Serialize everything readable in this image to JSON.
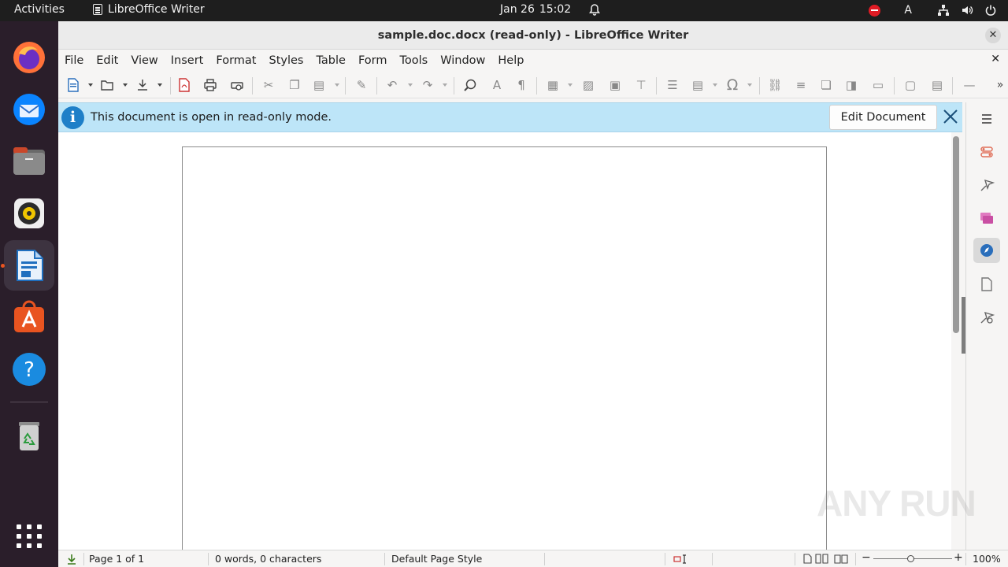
{
  "topbar": {
    "activities": "Activities",
    "app_name": "LibreOffice Writer",
    "date": "Jan 26",
    "time": "15:02",
    "input_indicator": "A"
  },
  "dock": {
    "items": [
      {
        "name": "firefox-icon"
      },
      {
        "name": "thunderbird-icon"
      },
      {
        "name": "files-icon"
      },
      {
        "name": "rhythmbox-icon"
      },
      {
        "name": "libreoffice-writer-icon"
      },
      {
        "name": "app-center-icon"
      },
      {
        "name": "help-icon"
      },
      {
        "name": "trash-icon"
      },
      {
        "name": "show-apps-icon"
      }
    ]
  },
  "window": {
    "title": "sample.doc.docx (read-only) - LibreOffice Writer",
    "close_glyph": "✕"
  },
  "menubar": {
    "items": [
      "File",
      "Edit",
      "View",
      "Insert",
      "Format",
      "Styles",
      "Table",
      "Form",
      "Tools",
      "Window",
      "Help"
    ],
    "close_glyph": "✕"
  },
  "infobar": {
    "message": "This document is open in read-only mode.",
    "edit_button": "Edit Document",
    "info_glyph": "i"
  },
  "statusbar": {
    "page": "Page 1 of 1",
    "words": "0 words, 0 characters",
    "page_style": "Default Page Style",
    "zoom": "100%"
  },
  "watermark": "ANY RUN",
  "colors": {
    "infobar_bg": "#bde5f8",
    "info_icon": "#1e7fc8",
    "dock_bg": "#2a1e2a",
    "topbar_bg": "#1e1e1e",
    "accent": "#e95420"
  }
}
